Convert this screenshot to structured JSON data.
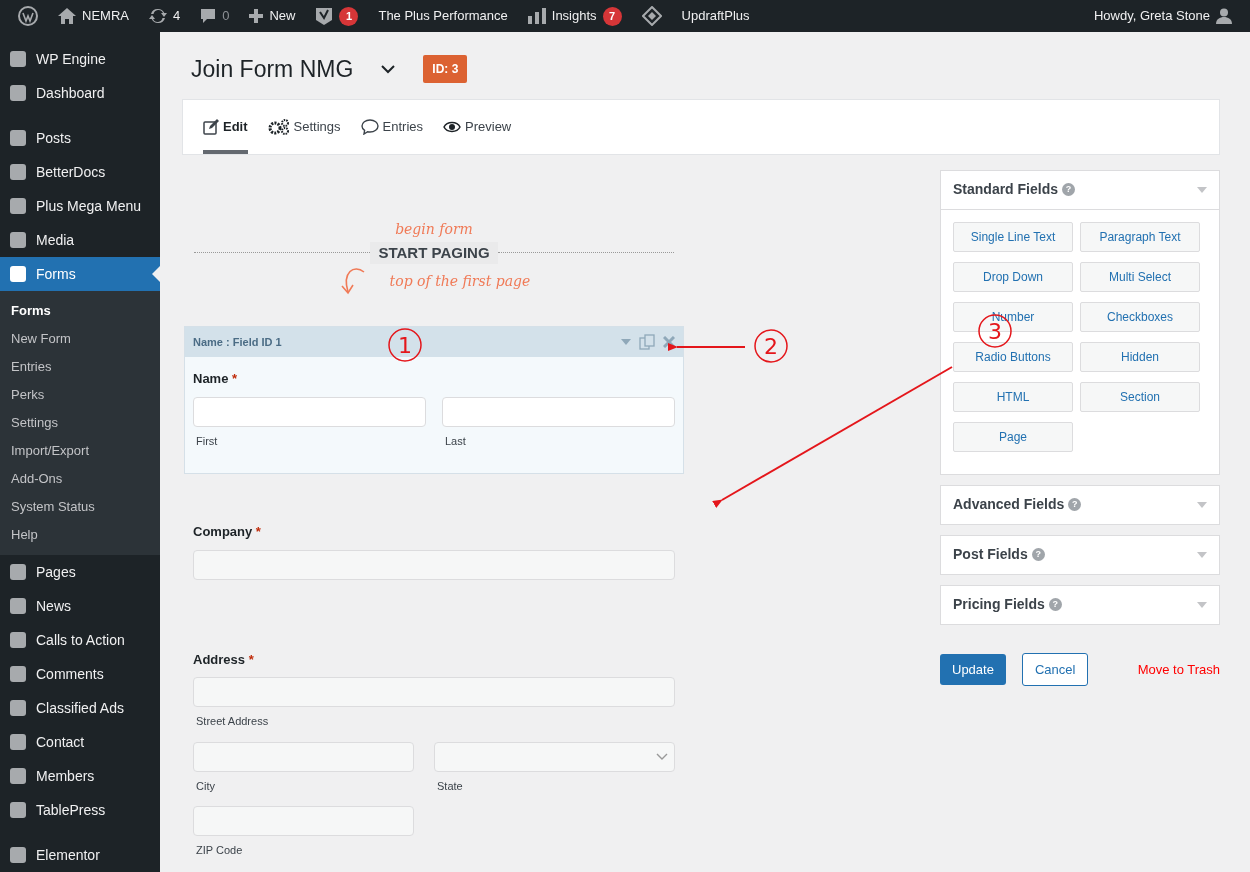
{
  "admin_bar": {
    "items": [
      {
        "kind": "logo"
      },
      {
        "kind": "site",
        "label": "NEMRA"
      },
      {
        "kind": "updates",
        "label": "4"
      },
      {
        "kind": "comments",
        "label": "0"
      },
      {
        "kind": "new",
        "label": "New"
      },
      {
        "kind": "seo",
        "badge": "1"
      },
      {
        "kind": "text",
        "label": "The Plus Performance"
      },
      {
        "kind": "insights",
        "label": "Insights",
        "badge": "7"
      },
      {
        "kind": "plugin"
      },
      {
        "kind": "text",
        "label": "UpdraftPlus"
      }
    ],
    "greeting": "Howdy, Greta Stone"
  },
  "sidebar": {
    "groups": [
      {
        "items": [
          {
            "label": "WP Engine",
            "selected": false
          },
          {
            "label": "Dashboard",
            "selected": false
          }
        ]
      },
      {
        "items": [
          {
            "label": "Posts",
            "selected": false
          },
          {
            "label": "BetterDocs",
            "selected": false
          },
          {
            "label": "Plus Mega Menu",
            "selected": false
          },
          {
            "label": "Media",
            "selected": false
          },
          {
            "label": "Forms",
            "selected": true,
            "children": [
              {
                "label": "Forms",
                "selected": true
              },
              {
                "label": "New Form",
                "selected": false
              },
              {
                "label": "Entries",
                "selected": false
              },
              {
                "label": "Perks",
                "selected": false
              },
              {
                "label": "Settings",
                "selected": false
              },
              {
                "label": "Import/Export",
                "selected": false
              },
              {
                "label": "Add-Ons",
                "selected": false
              },
              {
                "label": "System Status",
                "selected": false
              },
              {
                "label": "Help",
                "selected": false
              }
            ]
          },
          {
            "label": "Pages",
            "selected": false
          },
          {
            "label": "News",
            "selected": false
          },
          {
            "label": "Calls to Action",
            "selected": false
          },
          {
            "label": "Comments",
            "selected": false
          },
          {
            "label": "Classified Ads",
            "selected": false
          },
          {
            "label": "Contact",
            "selected": false
          },
          {
            "label": "Members",
            "selected": false
          },
          {
            "label": "TablePress",
            "selected": false
          }
        ]
      },
      {
        "items": [
          {
            "label": "Elementor",
            "selected": false
          }
        ]
      }
    ]
  },
  "form_header": {
    "title": "Join Form NMG",
    "id_badge": "ID: 3"
  },
  "tabs": [
    {
      "kind": "edit",
      "label": "Edit",
      "selected": true
    },
    {
      "kind": "settings",
      "label": "Settings",
      "selected": false
    },
    {
      "kind": "entries",
      "label": "Entries",
      "selected": false
    },
    {
      "kind": "preview",
      "label": "Preview",
      "selected": false
    }
  ],
  "start_paging": {
    "note_above": "begin form",
    "label": "START PAGING",
    "note_below": "top of the first page"
  },
  "fields": [
    {
      "kind": "name",
      "header": "Name : Field ID 1",
      "label": "Name",
      "required_mark": "*",
      "subfields": [
        {
          "label": "First",
          "kind": "text"
        },
        {
          "label": "Last",
          "kind": "text"
        }
      ]
    },
    {
      "kind": "text",
      "label": "Company",
      "required_mark": "*"
    },
    {
      "kind": "address",
      "label": "Address",
      "required_mark": "*",
      "subfields": [
        {
          "label": "Street Address",
          "kind": "text"
        },
        {
          "label": "City",
          "kind": "text"
        },
        {
          "label": "State",
          "kind": "select"
        },
        {
          "label": "ZIP Code",
          "kind": "text"
        }
      ]
    }
  ],
  "field_panels": [
    {
      "title": "Standard Fields",
      "help": "?",
      "buttons": [
        "Single Line Text",
        "Paragraph Text",
        "Drop Down",
        "Multi Select",
        "Number",
        "Checkboxes",
        "Radio Buttons",
        "Hidden",
        "HTML",
        "Section",
        "Page"
      ]
    },
    {
      "title": "Advanced Fields",
      "help": "?"
    },
    {
      "title": "Post Fields",
      "help": "?"
    },
    {
      "title": "Pricing Fields",
      "help": "?"
    }
  ],
  "actions": {
    "update": "Update",
    "cancel": "Cancel",
    "trash": "Move to Trash"
  },
  "annotations": [
    {
      "label": "1"
    },
    {
      "label": "2"
    },
    {
      "label": "3"
    }
  ]
}
